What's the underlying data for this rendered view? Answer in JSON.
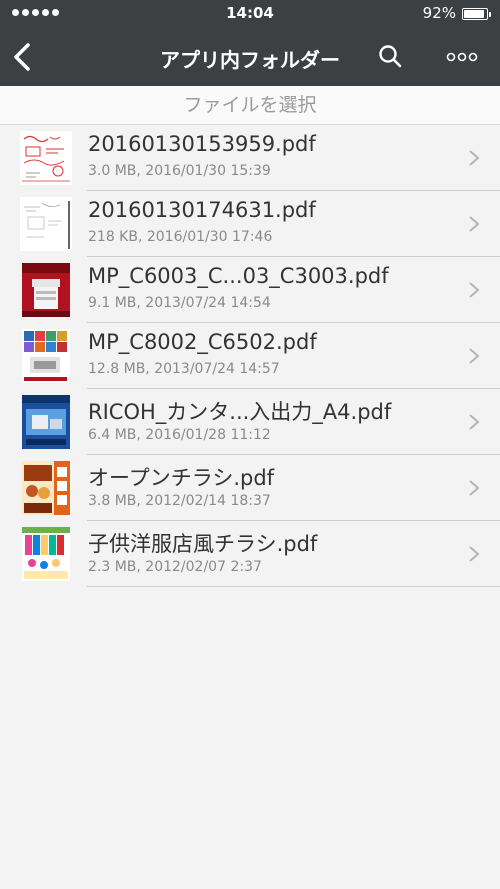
{
  "status_bar": {
    "time": "14:04",
    "battery": "92%",
    "battery_level": 0.92
  },
  "nav": {
    "title": "アプリ内フォルダー"
  },
  "subheader": {
    "text": "ファイルを選択"
  },
  "icons": {
    "back": "chevron-left-icon",
    "search": "search-icon",
    "more": "more-dots-icon",
    "row": "chevron-right-icon"
  },
  "colors": {
    "navbar": "#3d4042",
    "background": "#f3f3f3",
    "accent_red": "#c0172b"
  },
  "files": [
    {
      "name": "20160130153959.pdf",
      "meta": "3.0 MB, 2016/01/30 15:39"
    },
    {
      "name": "20160130174631.pdf",
      "meta": "218 KB, 2016/01/30 17:46"
    },
    {
      "name": "MP_C6003_C...03_C3003.pdf",
      "meta": "9.1 MB, 2013/07/24 14:54"
    },
    {
      "name": "MP_C8002_C6502.pdf",
      "meta": "12.8 MB, 2013/07/24 14:57"
    },
    {
      "name": "RICOH_カンタ...入出力_A4.pdf",
      "meta": "6.4 MB, 2016/01/28 11:12"
    },
    {
      "name": "オープンチラシ.pdf",
      "meta": "3.8 MB, 2012/02/14 18:37"
    },
    {
      "name": "子供洋服店風チラシ.pdf",
      "meta": "2.3 MB, 2012/02/07 2:37"
    }
  ]
}
